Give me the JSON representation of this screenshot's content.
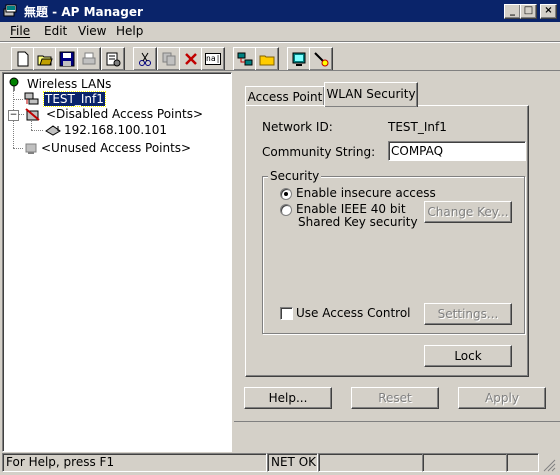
{
  "window": {
    "title": "無題 - AP Manager"
  },
  "caption_buttons": {
    "minimize": "_",
    "maximize": "□",
    "close": "×"
  },
  "menu": [
    {
      "label": "File",
      "mnemonic": "F"
    },
    {
      "label": "Edit",
      "mnemonic": "E"
    },
    {
      "label": "View",
      "mnemonic": "V"
    },
    {
      "label": "Help",
      "mnemonic": "H"
    }
  ],
  "menu_labels": {
    "file": "File",
    "edit": "Edit",
    "view": "View",
    "help": "Help"
  },
  "toolbar": {
    "buttons": [
      "new-icon",
      "open-icon",
      "save-icon",
      "print-icon",
      "properties-icon",
      "cut-icon",
      "copy-icon",
      "delete-icon",
      "rename-icon",
      "network-icon",
      "folder-icon",
      "connect-icon",
      "help-icon"
    ],
    "rename_glyph": "na|"
  },
  "tree": {
    "root": "Wireless LANs",
    "network": "TEST_Inf1",
    "disabled_group": "<Disabled Access Points>",
    "disabled_ap": "192.168.100.101",
    "unused_group": "<Unused Access Points>",
    "expander_minus": "−"
  },
  "tabs": {
    "access_point": "Access Point",
    "wlan_security": "WLAN Security",
    "active": "WLAN Security"
  },
  "panel": {
    "network_id_label": "Network ID:",
    "network_id_value": "TEST_Inf1",
    "community_label": "Community String:",
    "community_value": "COMPAQ",
    "security_group": "Security",
    "radio_insecure": "Enable insecure access",
    "radio_ieee_line1": "Enable IEEE 40 bit",
    "radio_ieee_line2": "Shared Key security",
    "selected_radio": "insecure",
    "change_key": "Change Key...",
    "use_access_control": "Use Access Control",
    "use_access_control_checked": false,
    "settings": "Settings...",
    "lock": "Lock"
  },
  "dialog_buttons": {
    "help": "Help...",
    "reset": "Reset",
    "apply": "Apply"
  },
  "status": {
    "help_text": "For Help, press F1",
    "net": "NET OK"
  },
  "colors": {
    "title_bar": "#0a246a",
    "face": "#d4d0c8",
    "selection": "#0a246a"
  }
}
